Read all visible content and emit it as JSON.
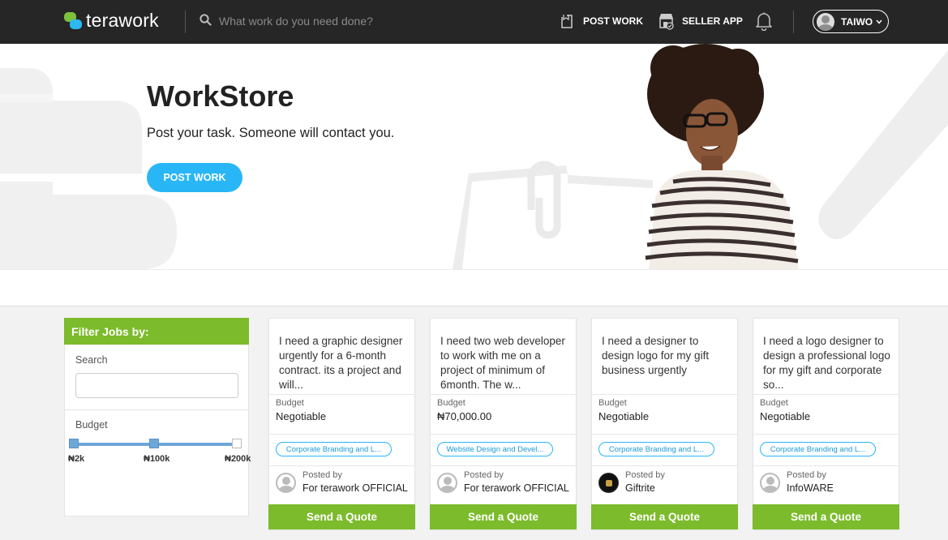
{
  "nav": {
    "brand": "terawork",
    "search_placeholder": "What work do you need done?",
    "post_work": "POST WORK",
    "seller_app": "SELLER APP",
    "user_name": "TAIWO"
  },
  "hero": {
    "title": "WorkStore",
    "subtitle": "Post your task. Someone will contact you.",
    "cta": "POST WORK"
  },
  "filter": {
    "header": "Filter Jobs by:",
    "search_label": "Search",
    "search_value": "",
    "budget_label": "Budget",
    "ticks": [
      "₦2k",
      "₦100k",
      "₦200k"
    ]
  },
  "cards": [
    {
      "description": "I need a graphic designer urgently for a 6-month contract. its a project and will...",
      "budget_label": "Budget",
      "budget": "Negotiable",
      "tag": "Corporate Branding and L...",
      "posted_label": "Posted by",
      "poster": "For terawork OFFICIAL",
      "button": "Send a Quote"
    },
    {
      "description": "I need two web developer to work with me on a project of minimum of 6month. The w...",
      "budget_label": "Budget",
      "budget": "₦70,000.00",
      "tag": "Website Design and Devel...",
      "posted_label": "Posted by",
      "poster": "For terawork OFFICIAL",
      "button": "Send a Quote"
    },
    {
      "description": "I need a designer to design logo for my gift business urgently",
      "budget_label": "Budget",
      "budget": "Negotiable",
      "tag": "Corporate Branding and L...",
      "posted_label": "Posted by",
      "poster": "Giftrite",
      "button": "Send a Quote"
    },
    {
      "description": "I need a logo designer to design a professional logo for my gift and corporate so...",
      "budget_label": "Budget",
      "budget": "Negotiable",
      "tag": "Corporate Branding and L...",
      "posted_label": "Posted by",
      "poster": "InfoWARE",
      "button": "Send a Quote"
    }
  ],
  "colors": {
    "nav_bg": "#262626",
    "accent_green": "#7cbb2b",
    "accent_blue": "#29b6f6"
  }
}
